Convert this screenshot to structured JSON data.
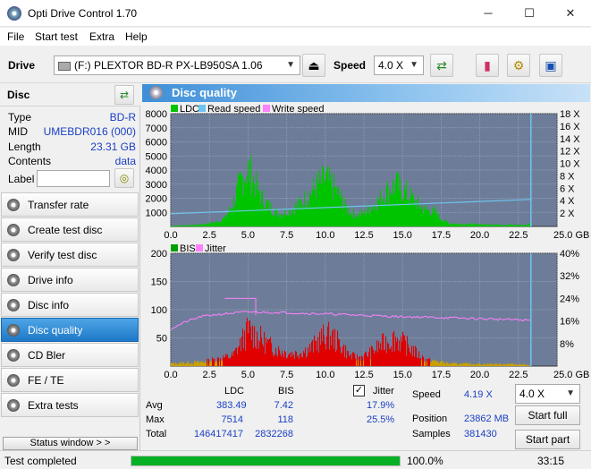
{
  "window": {
    "title": "Opti Drive Control 1.70"
  },
  "menu": [
    "File",
    "Start test",
    "Extra",
    "Help"
  ],
  "toolbar": {
    "drive_label": "Drive",
    "drive_value": "(F:)   PLEXTOR BD-R  PX-LB950SA 1.06",
    "speed_label": "Speed",
    "speed_value": "4.0 X"
  },
  "disc": {
    "header": "Disc",
    "type_k": "Type",
    "type_v": "BD-R",
    "mid_k": "MID",
    "mid_v": "UMEBDR016 (000)",
    "length_k": "Length",
    "length_v": "23.31 GB",
    "contents_k": "Contents",
    "contents_v": "data",
    "label_k": "Label"
  },
  "nav": [
    "Transfer rate",
    "Create test disc",
    "Verify test disc",
    "Drive info",
    "Disc info",
    "Disc quality",
    "CD Bler",
    "FE / TE",
    "Extra tests"
  ],
  "nav_active": 5,
  "status_window": "Status window > >",
  "panel": {
    "title": "Disc quality"
  },
  "chart_data": [
    {
      "type": "area",
      "legend": [
        "LDC",
        "Read speed",
        "Write speed"
      ],
      "colors": {
        "ldc": "#00c400",
        "read": "#6ec4f0",
        "write": "#ff80ff"
      },
      "x_ticks": [
        "0.0",
        "2.5",
        "5.0",
        "7.5",
        "10.0",
        "12.5",
        "15.0",
        "17.5",
        "20.0",
        "22.5",
        "25.0 GB"
      ],
      "y_left_ticks": [
        "8000",
        "7000",
        "6000",
        "5000",
        "4000",
        "3000",
        "2000",
        "1000"
      ],
      "y_right_ticks": [
        "18 X",
        "16 X",
        "14 X",
        "12 X",
        "10 X",
        "8 X",
        "6 X",
        "4 X",
        "2 X"
      ],
      "xlim": [
        0,
        25
      ],
      "ylim": [
        0,
        8000
      ],
      "ldc_profile": [
        [
          0,
          60
        ],
        [
          1,
          90
        ],
        [
          2,
          160
        ],
        [
          3,
          380
        ],
        [
          3.5,
          700
        ],
        [
          4,
          1800
        ],
        [
          4.5,
          3500
        ],
        [
          5,
          4500
        ],
        [
          5.3,
          3800
        ],
        [
          5.6,
          2800
        ],
        [
          6,
          2000
        ],
        [
          6.5,
          1400
        ],
        [
          7,
          1000
        ],
        [
          7.5,
          1200
        ],
        [
          8,
          1500
        ],
        [
          8.5,
          2000
        ],
        [
          9,
          2600
        ],
        [
          9.5,
          3300
        ],
        [
          10,
          3700
        ],
        [
          10.5,
          3100
        ],
        [
          11,
          2200
        ],
        [
          11.5,
          1200
        ],
        [
          12,
          900
        ],
        [
          12.5,
          1100
        ],
        [
          13,
          1600
        ],
        [
          13.5,
          2200
        ],
        [
          14,
          2800
        ],
        [
          14.5,
          3300
        ],
        [
          15,
          2900
        ],
        [
          15.5,
          2300
        ],
        [
          16,
          1700
        ],
        [
          16.5,
          1300
        ],
        [
          17,
          1200
        ],
        [
          17.5,
          600
        ],
        [
          18,
          240
        ],
        [
          19,
          200
        ],
        [
          20,
          170
        ],
        [
          21,
          150
        ],
        [
          22,
          130
        ],
        [
          23,
          100
        ],
        [
          23.2,
          300
        ],
        [
          23.31,
          0
        ]
      ],
      "read_speed": [
        [
          0,
          1.9
        ],
        [
          23.31,
          4.2
        ]
      ]
    },
    {
      "type": "area",
      "legend": [
        "BIS",
        "Jitter"
      ],
      "colors": {
        "bis": "#e00000",
        "jitter": "#ff80ff"
      },
      "x_ticks": [
        "0.0",
        "2.5",
        "5.0",
        "7.5",
        "10.0",
        "12.5",
        "15.0",
        "17.5",
        "20.0",
        "22.5",
        "25.0 GB"
      ],
      "y_left_ticks": [
        "200",
        "150",
        "100",
        "50"
      ],
      "y_right_ticks": [
        "40%",
        "32%",
        "24%",
        "16%",
        "8%"
      ],
      "xlim": [
        0,
        25
      ],
      "ylim": [
        0,
        200
      ],
      "bis_profile": [
        [
          0,
          5
        ],
        [
          2,
          8
        ],
        [
          3,
          14
        ],
        [
          4,
          20
        ],
        [
          4.5,
          45
        ],
        [
          5,
          70
        ],
        [
          5.5,
          60
        ],
        [
          6,
          48
        ],
        [
          6.5,
          38
        ],
        [
          7,
          30
        ],
        [
          7.5,
          26
        ],
        [
          8,
          24
        ],
        [
          8.5,
          28
        ],
        [
          9,
          34
        ],
        [
          9.5,
          48
        ],
        [
          10,
          60
        ],
        [
          10.5,
          55
        ],
        [
          11,
          40
        ],
        [
          11.5,
          22
        ],
        [
          12,
          16
        ],
        [
          12.5,
          20
        ],
        [
          13,
          28
        ],
        [
          13.5,
          40
        ],
        [
          14,
          48
        ],
        [
          14.5,
          55
        ],
        [
          15,
          45
        ],
        [
          15.5,
          35
        ],
        [
          16,
          22
        ],
        [
          16.5,
          12
        ],
        [
          17,
          10
        ],
        [
          17.5,
          8
        ],
        [
          18,
          5
        ],
        [
          20,
          4
        ],
        [
          22,
          4
        ],
        [
          23,
          3
        ],
        [
          23.31,
          0
        ]
      ],
      "jitter_profile": [
        [
          0,
          13.2
        ],
        [
          1,
          15.8
        ],
        [
          2,
          17.6
        ],
        [
          3,
          18.3
        ],
        [
          4,
          18.8
        ],
        [
          5,
          19.2
        ],
        [
          7,
          19.0
        ],
        [
          10,
          18.5
        ],
        [
          12.5,
          18.0
        ],
        [
          15,
          17.5
        ],
        [
          17.5,
          17.2
        ],
        [
          20,
          16.8
        ],
        [
          22.5,
          16.4
        ],
        [
          23.31,
          16.2
        ]
      ]
    }
  ],
  "stats": {
    "col_ldc": "LDC",
    "col_bis": "BIS",
    "col_jitter": "Jitter",
    "avg_label": "Avg",
    "max_label": "Max",
    "total_label": "Total",
    "avg_ldc": "383.49",
    "avg_bis": "7.42",
    "avg_jitter": "17.9%",
    "max_ldc": "7514",
    "max_bis": "118",
    "max_jitter": "25.5%",
    "total_ldc": "146417417",
    "total_bis": "2832268",
    "speed_label": "Speed",
    "speed_value": "4.19 X",
    "position_label": "Position",
    "position_value": "23862 MB",
    "samples_label": "Samples",
    "samples_value": "381430",
    "speed_select": "4.0 X",
    "start_full": "Start full",
    "start_part": "Start part"
  },
  "status": {
    "text": "Test completed",
    "progress_value": 1.0,
    "progress_label": "100.0%",
    "elapsed": "33:15"
  }
}
